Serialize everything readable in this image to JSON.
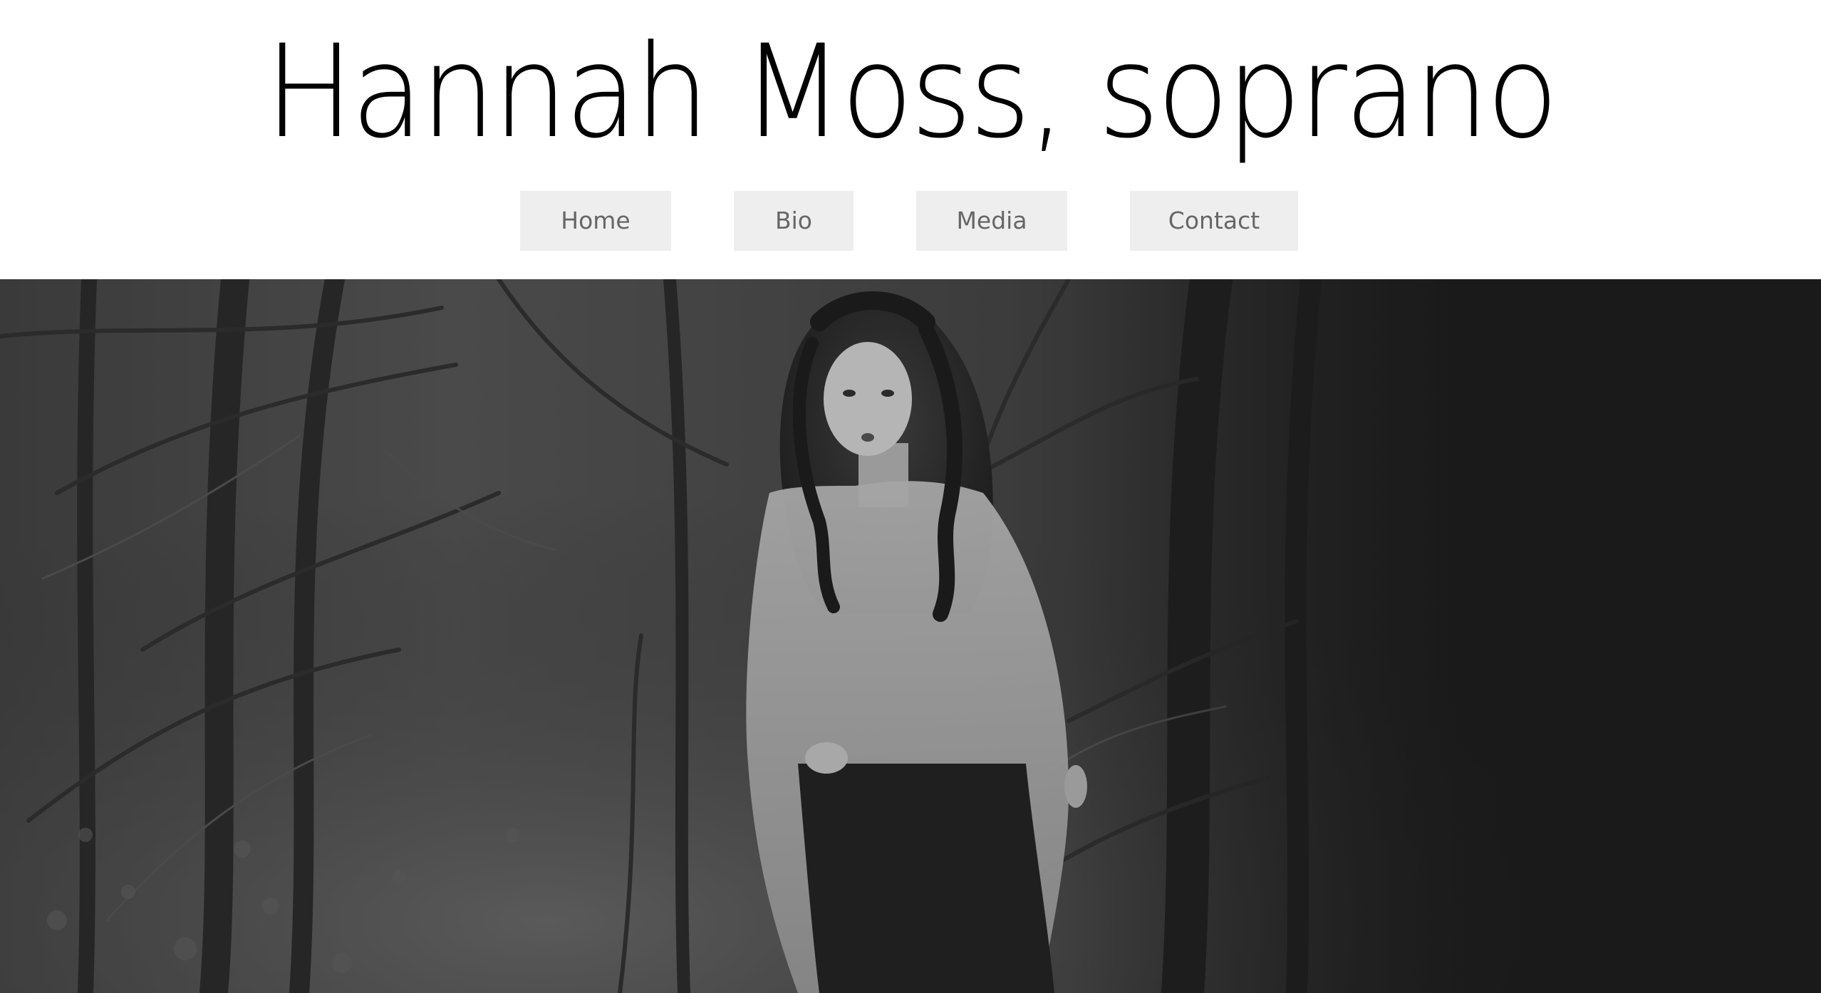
{
  "header": {
    "title": "Hannah Moss, soprano"
  },
  "nav": {
    "items": [
      {
        "label": "Home"
      },
      {
        "label": "Bio"
      },
      {
        "label": "Media"
      },
      {
        "label": "Contact"
      }
    ]
  },
  "hero": {
    "image": "black-and-white-photo-woman-in-forest"
  },
  "colors": {
    "nav_bg": "#eeeeee",
    "nav_text": "#666666",
    "title": "#000000",
    "background": "#ffffff"
  }
}
